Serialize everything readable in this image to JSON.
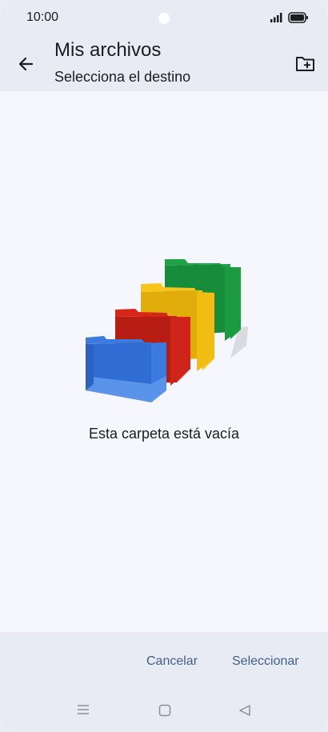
{
  "status_bar": {
    "time": "10:00"
  },
  "header": {
    "title": "Mis archivos",
    "subtitle": "Selecciona el destino",
    "back_icon": "arrow-left-icon",
    "action_icon": "new-folder-icon"
  },
  "main": {
    "empty_message": "Esta carpeta está vacía",
    "illustration": "empty-folder-illustration"
  },
  "actions": {
    "cancel_label": "Cancelar",
    "select_label": "Seleccionar"
  },
  "nav_bar": {
    "menu_icon": "menu-icon",
    "home_icon": "home-icon",
    "back_icon": "back-triangle-icon"
  },
  "colors": {
    "accent": "#3f5f8f",
    "folder_blue": "#3b7be0",
    "folder_red": "#d8261b",
    "folder_yellow": "#f7c51c",
    "folder_green": "#1fa245"
  }
}
